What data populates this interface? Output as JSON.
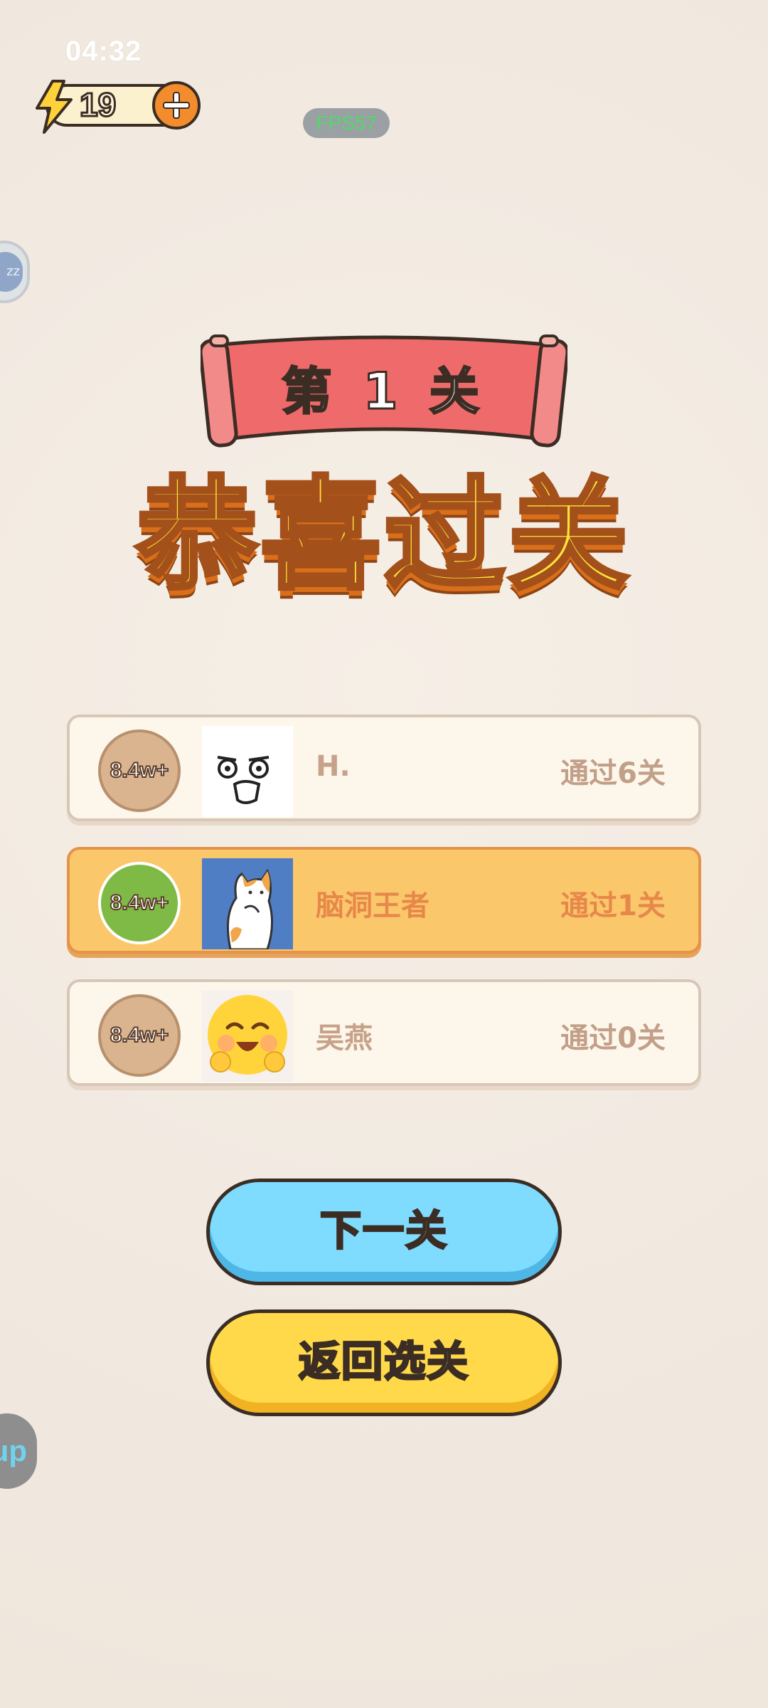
{
  "status_bar": {
    "time": "04:32"
  },
  "energy": {
    "value": "19"
  },
  "fps": "FPS57",
  "side_widgets": {
    "bubble_text": "zz",
    "up_text": "up"
  },
  "banner": {
    "label": "第 1 关"
  },
  "title": "恭喜过关",
  "rankings": [
    {
      "badge": "8.4w+",
      "name": "H.",
      "passed": "通过6关",
      "avatar": "doodle-face"
    },
    {
      "badge": "8.4w+",
      "name": "脑洞王者",
      "passed": "通过1关",
      "avatar": "cat"
    },
    {
      "badge": "8.4w+",
      "name": "吴燕",
      "passed": "通过0关",
      "avatar": "smiling-emoji"
    }
  ],
  "buttons": {
    "next": "下一关",
    "back": "返回选关"
  },
  "colors": {
    "background": "#f3ebe2",
    "banner_red": "#ef6b6b",
    "title_yellow": "#ffe43a",
    "active_card": "#fbc76b",
    "next_button": "#7fdcff",
    "back_button": "#ffd94a"
  }
}
